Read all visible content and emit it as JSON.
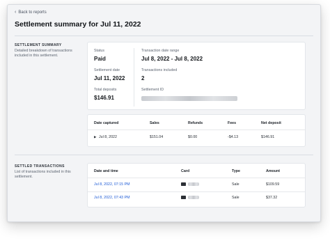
{
  "nav": {
    "back_label": "Back to reports"
  },
  "page": {
    "title": "Settlement summary for Jul 11, 2022"
  },
  "settlement_summary": {
    "heading": "SETTLEMENT SUMMARY",
    "description": "Detailed breakdown of transactions included in this settlement.",
    "status_label": "Status",
    "status_value": "Paid",
    "settlement_date_label": "Settlement date",
    "settlement_date_value": "Jul 11, 2022",
    "total_deposits_label": "Total deposits",
    "total_deposits_value": "$146.91",
    "date_range_label": "Transaction date range",
    "date_range_value": "Jul 8, 2022 - Jul 8, 2022",
    "transactions_included_label": "Transactions included",
    "transactions_included_value": "2",
    "settlement_id_label": "Settlement ID"
  },
  "breakdown_table": {
    "columns": [
      "Date captured",
      "Sales",
      "Refunds",
      "Fees",
      "Net deposit"
    ],
    "rows": [
      {
        "date": "Jul 8, 2022",
        "sales": "$151.04",
        "refunds": "$0.00",
        "fees": "-$4.13",
        "net": "$146.91"
      }
    ]
  },
  "settled_transactions": {
    "heading": "SETTLED TRANSACTIONS",
    "description": "List of transactions included in this settlement.",
    "columns": [
      "Date and time",
      "Card",
      "Type",
      "Amount"
    ],
    "rows": [
      {
        "datetime": "Jul 8, 2022, 07:15 PM",
        "type": "Sale",
        "amount": "$109.59"
      },
      {
        "datetime": "Jul 8, 2022, 07:43 PM",
        "type": "Sale",
        "amount": "$37.32"
      }
    ]
  },
  "icons": {
    "back": "chevron-left-icon",
    "expand": "caret-right-icon",
    "card": "credit-card-icon"
  }
}
